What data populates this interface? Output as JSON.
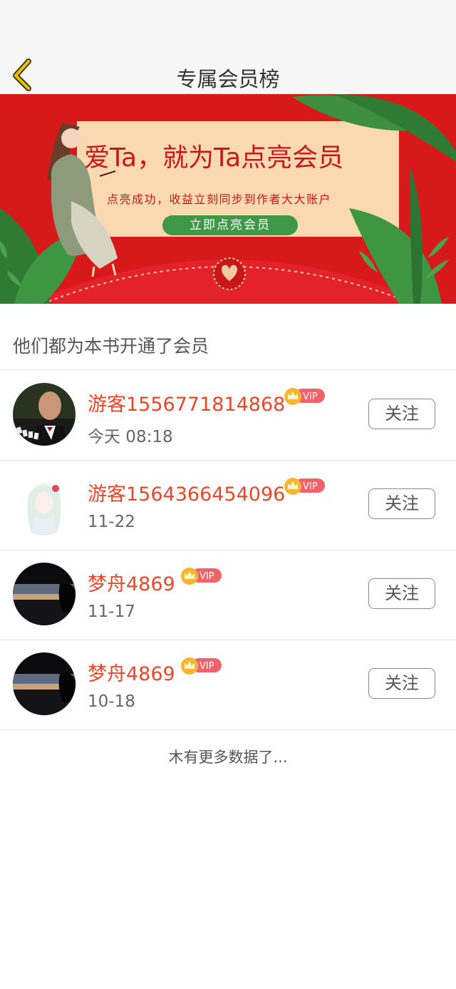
{
  "header": {
    "title": "专属会员榜",
    "back_icon": "chevron-left-icon"
  },
  "banner": {
    "headline": "爱Ta，就为Ta点亮会员",
    "subtitle": "点亮成功，收益立刻同步到作者大大账户",
    "button_label": "立即点亮会员"
  },
  "section_title": "他们都为本书开通了会员",
  "members": [
    {
      "name": "游客1556771814868",
      "vip": "VIP",
      "date": "今天 08:18",
      "follow_label": "关注"
    },
    {
      "name": "游客1564366454096",
      "vip": "VIP",
      "date": "11-22",
      "follow_label": "关注"
    },
    {
      "name": "梦舟4869",
      "vip": "VIP",
      "date": "11-17",
      "follow_label": "关注"
    },
    {
      "name": "梦舟4869",
      "vip": "VIP",
      "date": "10-18",
      "follow_label": "关注"
    }
  ],
  "footer_note": "木有更多数据了...",
  "colors": {
    "accent": "#e8472a",
    "banner_red": "#d8191a",
    "banner_green": "#3e9845"
  }
}
